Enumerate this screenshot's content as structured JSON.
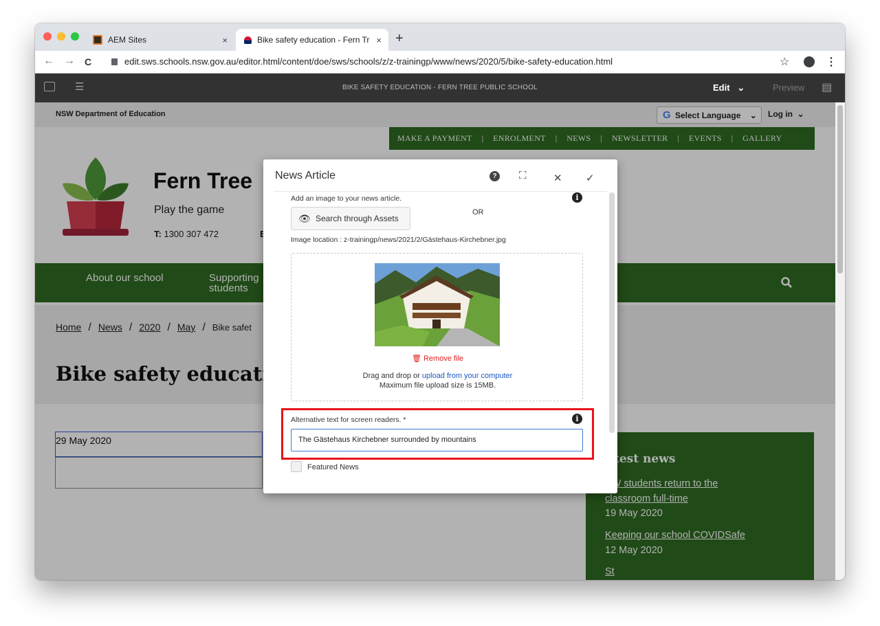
{
  "browser": {
    "tabs": [
      {
        "label": "AEM Sites",
        "close": "×"
      },
      {
        "label": "Bike safety education - Fern Tr",
        "close": "×"
      }
    ],
    "new_tab": "+",
    "url": "edit.sws.schools.nsw.gov.au/editor.html/content/doe/sws/schools/z/z-trainingp/www/news/2020/5/bike-safety-education.html",
    "back": "←",
    "forward": "→",
    "reload": "C",
    "star": "☆",
    "menu": "⋮"
  },
  "aem": {
    "page_title": "BIKE SAFETY EDUCATION - FERN TREE PUBLIC SCHOOL",
    "edit_label": "Edit",
    "edit_chevron": "⌄",
    "preview_label": "Preview"
  },
  "site": {
    "department": "NSW Department of Education",
    "select_language": "Select Language",
    "select_chevron": "⌄",
    "login": "Log in",
    "login_chevron": "⌄",
    "top_nav": [
      "MAKE A PAYMENT",
      "ENROLMENT",
      "NEWS",
      "NEWSLETTER",
      "EVENTS",
      "GALLERY"
    ],
    "top_nav_sep": "|",
    "school_name": "Fern Tree",
    "motto": "Play the game",
    "phone_label": "T:",
    "phone": "1300 307 472",
    "phone_trail": "E",
    "main_nav": [
      "About our school",
      "Supporting",
      "students"
    ],
    "search_icon": "search-icon",
    "breadcrumb": [
      "Home",
      "News",
      "2020",
      "May",
      "Bike safet"
    ],
    "breadcrumb_sep": "/",
    "title": "Bike safety educatio",
    "date": "29 May 2020",
    "latest_news": {
      "heading": "atest news",
      "items": [
        {
          "title": "SW students return to the classroom full-time",
          "date": "19 May 2020"
        },
        {
          "title": "Keeping our school COVIDSafe",
          "date": "12 May 2020"
        },
        {
          "title": "St",
          "date": ""
        }
      ]
    },
    "colors": {
      "green": "#2e6b22",
      "highlight": "#e8121a",
      "link": "#1a58c4"
    }
  },
  "dialog": {
    "title": "News Article",
    "help_icon": "?",
    "fullscreen_icon": "⛶",
    "close_icon": "✕",
    "confirm_icon": "✓",
    "image_label": "Add an image to your news article.",
    "or_label": "OR",
    "search_assets": "Search through Assets",
    "image_location": "Image location : z-trainingp/news/2021/2/Gästehaus-Kirchebner.jpg",
    "remove_file": "Remove file",
    "drag_text": "Drag and drop or",
    "upload_link": "upload from your computer",
    "max_size": "Maximum file upload size is 15MB.",
    "alt_label": "Alternative text for screen readers. *",
    "alt_value": "The Gästehaus Kirchebner surrounded by mountains",
    "featured_label": "Featured News",
    "info_icon": "i"
  }
}
